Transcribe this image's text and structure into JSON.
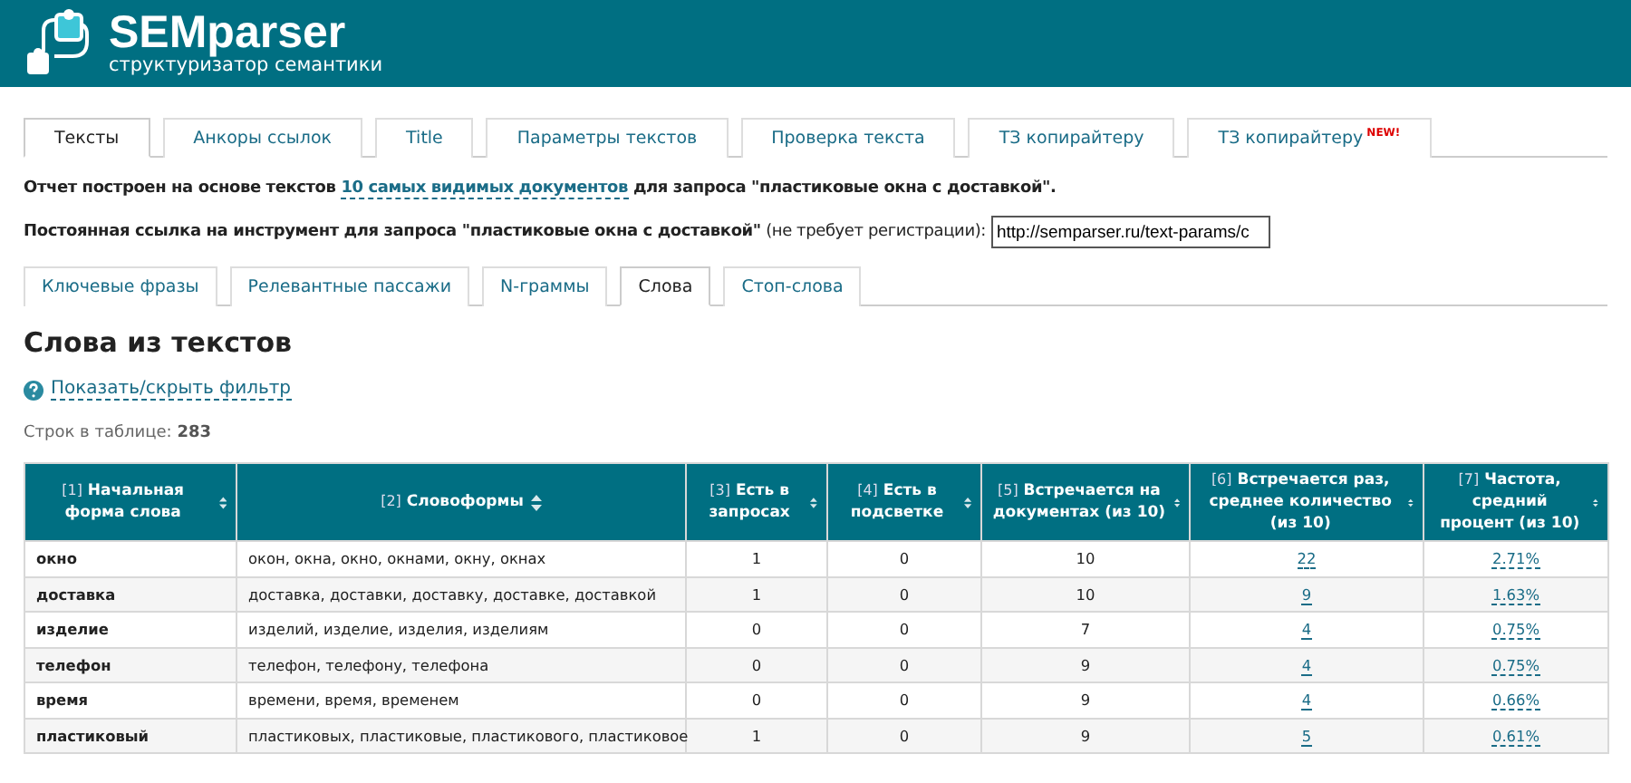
{
  "header": {
    "logo_title": "SEMparser",
    "logo_subtitle": "структуризатор семантики"
  },
  "tabs": [
    {
      "label": "Тексты",
      "selected": true
    },
    {
      "label": "Анкоры ссылок",
      "selected": false
    },
    {
      "label": "Title",
      "selected": false
    },
    {
      "label": "Параметры текстов",
      "selected": false
    },
    {
      "label": "Проверка текста",
      "selected": false
    },
    {
      "label": "ТЗ копирайтеру",
      "selected": false
    },
    {
      "label": "ТЗ копирайтеру",
      "selected": false,
      "badge": "NEW!"
    }
  ],
  "report_line": {
    "prefix": "Отчет построен на основе текстов ",
    "link": "10 самых видимых документов",
    "suffix": " для запроса \"пластиковые окна с доставкой\"."
  },
  "permalink": {
    "label": "**Постоянная ссылка на инструмент для запроса \"пластиковые окна с доставкой\"** (не требует регистрации):",
    "value": "http://semparser.ru/text-params/c"
  },
  "subtabs": [
    {
      "label": "Ключевые фразы",
      "selected": false
    },
    {
      "label": "Релевантные пассажи",
      "selected": false
    },
    {
      "label": "N-граммы",
      "selected": false
    },
    {
      "label": "Слова",
      "selected": true
    },
    {
      "label": "Стоп-слова",
      "selected": false
    }
  ],
  "section_title": "Слова из текстов",
  "filter_link": "Показать/скрыть фильтр",
  "row_count": {
    "label": "Строк в таблице: ",
    "value": "283"
  },
  "table": {
    "columns": [
      {
        "index": "[1]",
        "label": "Начальная форма слова"
      },
      {
        "index": "[2]",
        "label": "Словоформы"
      },
      {
        "index": "[3]",
        "label": "Есть в запросах"
      },
      {
        "index": "[4]",
        "label": "Есть в подсветке"
      },
      {
        "index": "[5]",
        "label": "Встречается на документах (из 10)"
      },
      {
        "index": "[6]",
        "label": "Встречается раз, среднее количество (из 10)"
      },
      {
        "index": "[7]",
        "label": "Частота, средний процент (из 10)"
      }
    ],
    "rows": [
      [
        "окно",
        "окон, окна, окно, окнами, окну, окнах",
        "1",
        "0",
        "10",
        "22",
        "2.71%"
      ],
      [
        "доставка",
        "доставка, доставки, доставку, доставке, доставкой",
        "1",
        "0",
        "10",
        "9",
        "1.63%"
      ],
      [
        "изделие",
        "изделий, изделие, изделия, изделиям",
        "0",
        "0",
        "7",
        "4",
        "0.75%"
      ],
      [
        "телефон",
        "телефон, телефону, телефона",
        "0",
        "0",
        "9",
        "4",
        "0.75%"
      ],
      [
        "время",
        "времени, время, временем",
        "0",
        "0",
        "9",
        "4",
        "0.66%"
      ],
      [
        "пластиковый",
        "пластиковых, пластиковые, пластикового, пластиковое",
        "1",
        "0",
        "9",
        "5",
        "0.61%"
      ]
    ]
  }
}
